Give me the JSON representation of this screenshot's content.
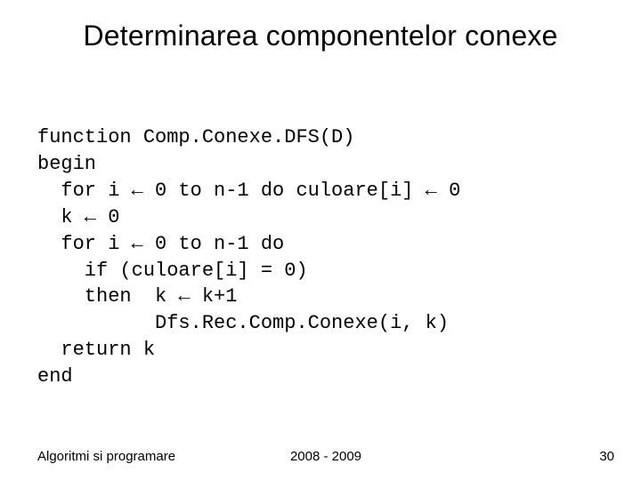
{
  "title": "Determinarea componentelor conexe",
  "code": "function Comp.Conexe.DFS(D)\nbegin\n  for i ← 0 to n-1 do culoare[i] ← 0\n  k ← 0\n  for i ← 0 to n-1 do\n    if (culoare[i] = 0)\n    then  k ← k+1\n          Dfs.Rec.Comp.Conexe(i, k)\n  return k\nend",
  "footer": {
    "left": "Algoritmi si programare",
    "center": "2008 - 2009",
    "right": "30"
  }
}
